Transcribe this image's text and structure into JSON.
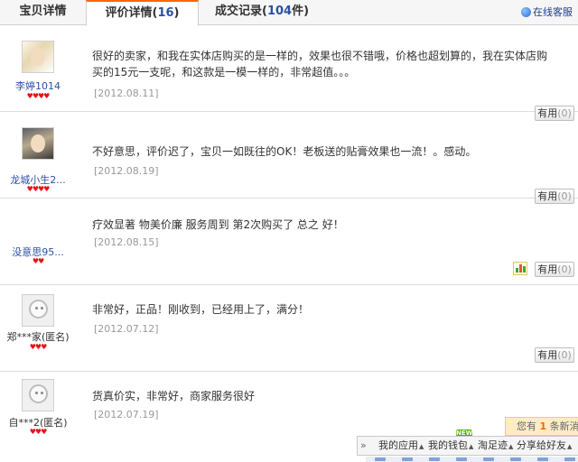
{
  "tabs": {
    "details": "宝贝详情",
    "reviews_label": "评价详情",
    "reviews_open": "(",
    "reviews_count": "16",
    "reviews_close": ")",
    "records_label": "成交记录",
    "records_open": "(",
    "records_count": "104",
    "records_close": "件)"
  },
  "service": {
    "label": "在线客服",
    "icon": "headset-icon"
  },
  "reviews": [
    {
      "user": "李婷1014",
      "content": "很好的卖家，和我在实体店购买的是一样的，效果也很不错哦，价格也超划算的，我在实体店购买的15元一支呢，和这款是一模一样的，非常超值。。。",
      "date": "[2012.08.11]",
      "useful_label": "有用",
      "useful_count": "(0)",
      "rating": "♥♥♥♥"
    },
    {
      "user": "龙城小生2...",
      "content": "不好意思，评价迟了，宝贝一如既往的OK！老板送的贴膏效果也一流！。感动。",
      "date": "[2012.08.19]",
      "useful_label": "有用",
      "useful_count": "(0)",
      "rating": "♥♥♥♥"
    },
    {
      "user": "没意思95...",
      "content": "疗效显著 物美价廉 服务周到 第2次购买了 总之 好！",
      "date": "[2012.08.15]",
      "useful_label": "有用",
      "useful_count": "(0)",
      "rating": "♥♥"
    },
    {
      "user": "郑***家(匿名)",
      "content": "非常好，正品！刚收到，已经用上了，满分！",
      "date": "[2012.07.12]",
      "useful_label": "有用",
      "useful_count": "(0)",
      "rating": "♥♥♥"
    },
    {
      "user": "自***2(匿名)",
      "content": "货真价实，非常好，商家服务很好",
      "date": "[2012.07.19]",
      "useful_label": "有用",
      "useful_count": "(0)",
      "rating": "♥♥♥"
    }
  ],
  "notice": {
    "prefix": "您有",
    "count": "1",
    "suffix": "条新消息"
  },
  "toolbar": {
    "collapse": "»",
    "items": [
      "我的应用",
      "我的钱包",
      "淘足迹",
      "分享给好友"
    ],
    "new_badge": "NEW"
  },
  "colors": {
    "accent": "#ff6600",
    "link": "#2d4fa5",
    "rating": "#e5131b"
  }
}
